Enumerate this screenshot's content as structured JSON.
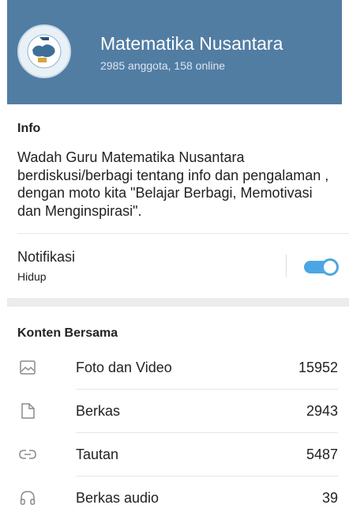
{
  "group": {
    "name": "Matematika Nusantara",
    "subtitle": "2985 anggota, 158 online"
  },
  "info": {
    "heading": "Info",
    "description": "Wadah Guru Matematika Nusantara berdiskusi/berbagi tentang info dan pengalaman , dengan moto kita \"Belajar Berbagi, Memotivasi dan Menginspirasi\"."
  },
  "notifications": {
    "label": "Notifikasi",
    "status": "Hidup",
    "enabled": true
  },
  "shared_content": {
    "heading": "Konten Bersama",
    "items": [
      {
        "icon": "image-icon",
        "label": "Foto dan Video",
        "count": "15952"
      },
      {
        "icon": "file-icon",
        "label": "Berkas",
        "count": "2943"
      },
      {
        "icon": "link-icon",
        "label": "Tautan",
        "count": "5487"
      },
      {
        "icon": "headphones-icon",
        "label": "Berkas audio",
        "count": "39"
      }
    ]
  },
  "colors": {
    "header": "#527da3",
    "toggle_accent": "#4da6e4"
  }
}
